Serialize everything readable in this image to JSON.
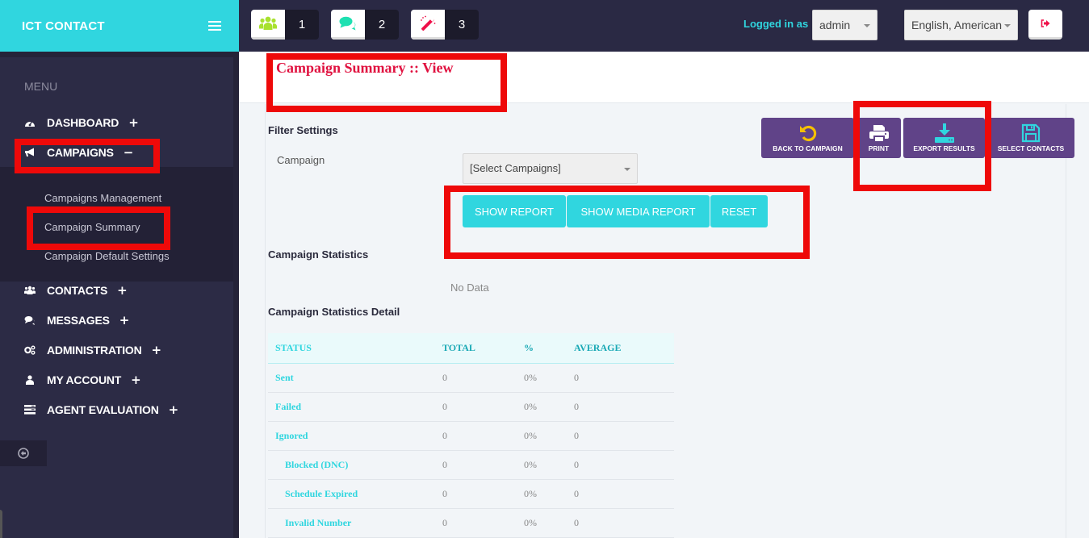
{
  "sidebar": {
    "brand": "ICT CONTACT",
    "menu_caption": "MENU",
    "items": [
      {
        "label": "DASHBOARD",
        "toggle": "+",
        "icon": "dashboard-icon"
      },
      {
        "label": "CAMPAIGNS",
        "toggle": "−",
        "icon": "bullhorn-icon"
      },
      {
        "label": "CONTACTS",
        "toggle": "+",
        "icon": "users-icon"
      },
      {
        "label": "MESSAGES",
        "toggle": "+",
        "icon": "comments-icon"
      },
      {
        "label": "ADMINISTRATION",
        "toggle": "+",
        "icon": "cogs-icon"
      },
      {
        "label": "MY ACCOUNT",
        "toggle": "+",
        "icon": "user-icon"
      },
      {
        "label": "AGENT EVALUATION",
        "toggle": "+",
        "icon": "list-icon"
      }
    ],
    "campaigns_submenu": [
      "Campaigns Management",
      "Campaign Summary",
      "Campaign Default Settings"
    ]
  },
  "topbar": {
    "badges": [
      {
        "icon": "users-icon",
        "count": "1",
        "color": "#a8e12e"
      },
      {
        "icon": "comments-icon",
        "count": "2",
        "color": "#1ee0b1"
      },
      {
        "icon": "magic-wand-icon",
        "count": "3",
        "color": "#ef1049"
      }
    ],
    "logged_in_label": "Logged in as :",
    "user": "admin",
    "language": "English, American",
    "logout_icon": "sign-out-icon"
  },
  "page": {
    "title": "Campaign Summary :: View",
    "filter_title": "Filter Settings",
    "campaign_label": "Campaign",
    "campaign_select": "[Select Campaigns]",
    "buttons": {
      "show_report": "SHOW REPORT",
      "show_media_report": "SHOW MEDIA REPORT",
      "reset": "RESET"
    },
    "actions": {
      "back": "BACK TO CAMPAIGN",
      "print": "PRINT",
      "export": "EXPORT RESULTS",
      "select_contacts": "SELECT CONTACTS"
    },
    "stats_title": "Campaign Statistics",
    "no_data": "No Data",
    "detail_title": "Campaign Statistics Detail"
  },
  "table": {
    "headers": [
      "STATUS",
      "TOTAL",
      "%",
      "AVERAGE"
    ],
    "rows": [
      {
        "status": "Sent",
        "total": "0",
        "pct": "0%",
        "avg": "0",
        "indent": false
      },
      {
        "status": "Failed",
        "total": "0",
        "pct": "0%",
        "avg": "0",
        "indent": false
      },
      {
        "status": "Ignored",
        "total": "0",
        "pct": "0%",
        "avg": "0",
        "indent": false
      },
      {
        "status": "Blocked (DNC)",
        "total": "0",
        "pct": "0%",
        "avg": "0",
        "indent": true
      },
      {
        "status": "Schedule Expired",
        "total": "0",
        "pct": "0%",
        "avg": "0",
        "indent": true
      },
      {
        "status": "Invalid Number",
        "total": "0",
        "pct": "0%",
        "avg": "0",
        "indent": true
      }
    ]
  },
  "colors": {
    "accent": "#30d6df",
    "action_purple": "#604388",
    "highlight_red": "#ee0909",
    "title_red": "#e0113f"
  }
}
